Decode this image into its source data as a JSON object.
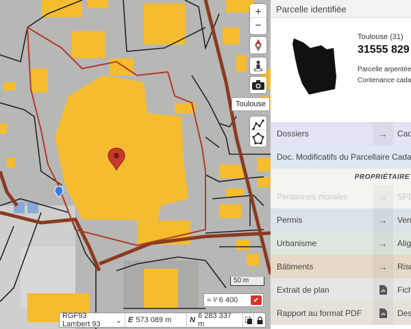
{
  "map": {
    "tooltip": "Toulouse",
    "scale_bar": "50 m",
    "scale_ratio": "≈ ¹⁄ 6 400",
    "projection": "RGF93 Lambert 93",
    "easting_prefix": "E",
    "easting": "573 089 m",
    "northing_prefix": "N",
    "northing": "6 283 337 m",
    "colors": {
      "building": "#f5bc2f",
      "boundary": "#a54a28",
      "road": "#8a3a22",
      "parcel_line": "#222222"
    }
  },
  "panel": {
    "title": "Parcelle identifiée",
    "commune": "Toulouse (31)",
    "parcel_id": "31555 829",
    "detail_1": "Parcelle arpentée",
    "detail_2": "Contenance cada",
    "rows": [
      {
        "label": "Dossiers",
        "extra": "Cada",
        "bg": "#e3e3f3",
        "icon": "→"
      },
      {
        "label": "Doc. Modificatifs du Parcellaire Cadastral",
        "extra": "",
        "bg": "#dde8f2",
        "icon": ""
      },
      {
        "label": "Personnes morales",
        "extra": "SPD",
        "bg": "#f3f5ef",
        "icon": "→",
        "muted": true
      },
      {
        "label": "Permis",
        "extra": "Vent",
        "bg": "#dbe2e8",
        "icon": "→"
      },
      {
        "label": "Urbanisme",
        "extra": "Align",
        "bg": "#dce8de",
        "icon": "→"
      },
      {
        "label": "Bâtiments",
        "extra": "Risq",
        "bg": "#e8d9c7",
        "icon": "→"
      },
      {
        "label": "Extrait de plan",
        "extra": "Fich",
        "bg": "#e6e6e6",
        "icon": "pdf"
      },
      {
        "label": "Rapport au format PDF",
        "extra": "Dess",
        "bg": "#e6e1da",
        "icon": "pdf"
      }
    ],
    "owners_heading": "PROPRIÉTAIRE"
  }
}
